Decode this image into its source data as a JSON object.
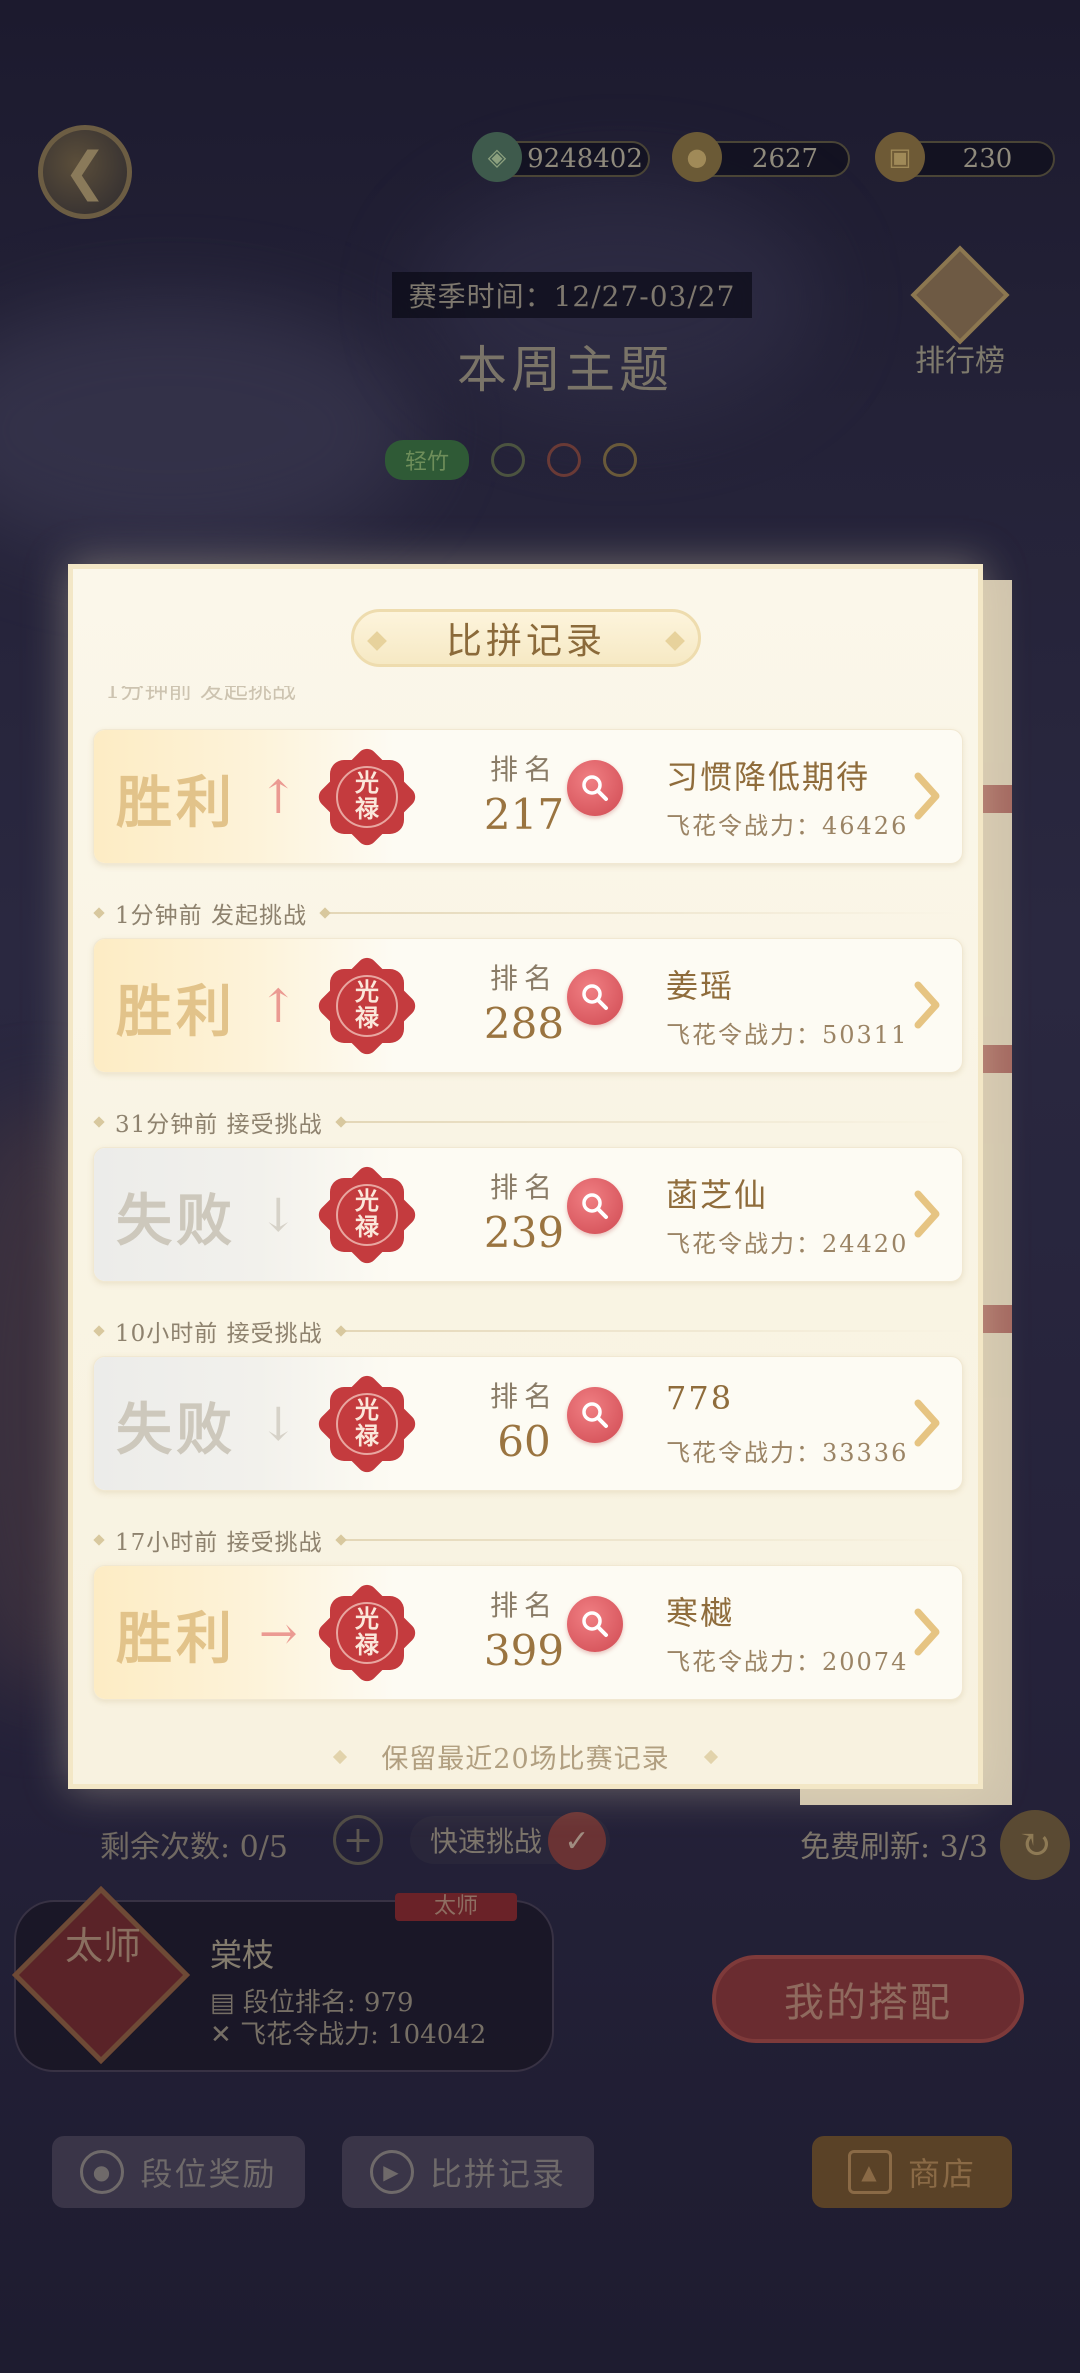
{
  "header": {
    "resources": [
      {
        "icon": "jade-currency-icon",
        "value": "9248402"
      },
      {
        "icon": "coin-currency-icon",
        "value": "2627"
      },
      {
        "icon": "scroll-ticket-icon",
        "value": "230"
      }
    ],
    "season_time": "赛季时间：12/27-03/27",
    "theme_title": "本周主题",
    "rank_board_label": "排行榜",
    "theme_tag": "轻竹"
  },
  "modal": {
    "title": "比拼记录",
    "footer_note": "保留最近20场比赛记录",
    "records": [
      {
        "time": "",
        "result": "胜利",
        "trend": "up",
        "badge": "光禄",
        "rank_label": "排名",
        "rank": "217",
        "opponent": "习惯降低期待",
        "power_label": "飞花令战力：",
        "power": "46426"
      },
      {
        "time": "1分钟前 发起挑战",
        "result": "胜利",
        "trend": "up",
        "badge": "光禄",
        "rank_label": "排名",
        "rank": "288",
        "opponent": "姜瑶",
        "power_label": "飞花令战力：",
        "power": "50311"
      },
      {
        "time": "31分钟前 接受挑战",
        "result": "失败",
        "trend": "down",
        "badge": "光禄",
        "rank_label": "排名",
        "rank": "239",
        "opponent": "菡芝仙",
        "power_label": "飞花令战力：",
        "power": "24420"
      },
      {
        "time": "10小时前 接受挑战",
        "result": "失败",
        "trend": "down",
        "badge": "光禄",
        "rank_label": "排名",
        "rank": "60",
        "opponent": "778",
        "power_label": "飞花令战力：",
        "power": "33336"
      },
      {
        "time": "17小时前 接受挑战",
        "result": "胜利",
        "trend": "flat",
        "badge": "光禄",
        "rank_label": "排名",
        "rank": "399",
        "opponent": "寒樾",
        "power_label": "飞花令战力：",
        "power": "20074"
      }
    ]
  },
  "bottom": {
    "remain_label": "剩余次数: 0/5",
    "quick_label": "快速挑战",
    "free_refresh": "免费刷新: 3/3",
    "player": {
      "title_badge": "太师",
      "rank_tag": "太师",
      "name": "棠枝",
      "rank_text": "段位排名: 979",
      "power_text": "飞花令战力: 104042"
    },
    "my_match": "我的搭配",
    "btn_rank_reward": "段位奖励",
    "btn_record": "比拼记录",
    "btn_shop": "商店"
  },
  "colors": {
    "win_text": "#e2c38a",
    "lose_text": "#cdc8bc",
    "badge_red": "#c43b3e",
    "title_brown": "#8b6a3a"
  }
}
